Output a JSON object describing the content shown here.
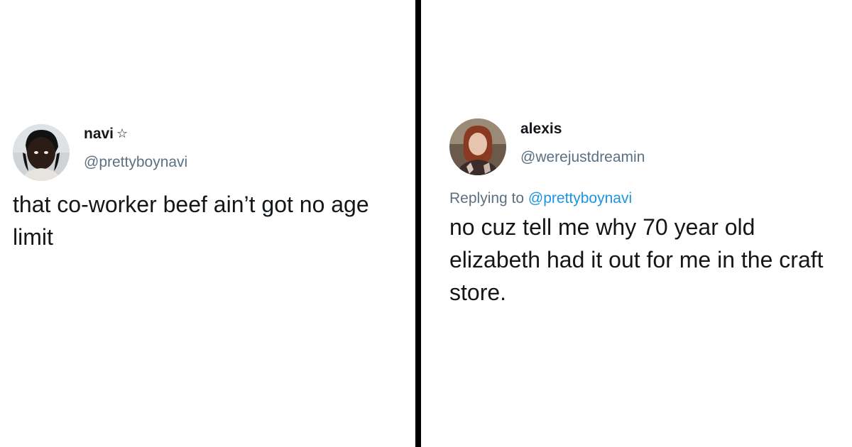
{
  "tweet_left": {
    "display_name": "navi",
    "badge": "☆",
    "handle": "@prettyboynavi",
    "text": "that co-worker beef ain’t got no age limit"
  },
  "tweet_right": {
    "display_name": "alexis",
    "handle": "@werejustdreamin",
    "replying_prefix": "Replying to",
    "replying_to": "@prettyboynavi",
    "text": "no cuz tell me why 70 year old elizabeth had it out for me in the craft store."
  },
  "colors": {
    "text": "#14171a",
    "secondary": "#5b7083",
    "link": "#1b95e0",
    "divider": "#000000"
  }
}
